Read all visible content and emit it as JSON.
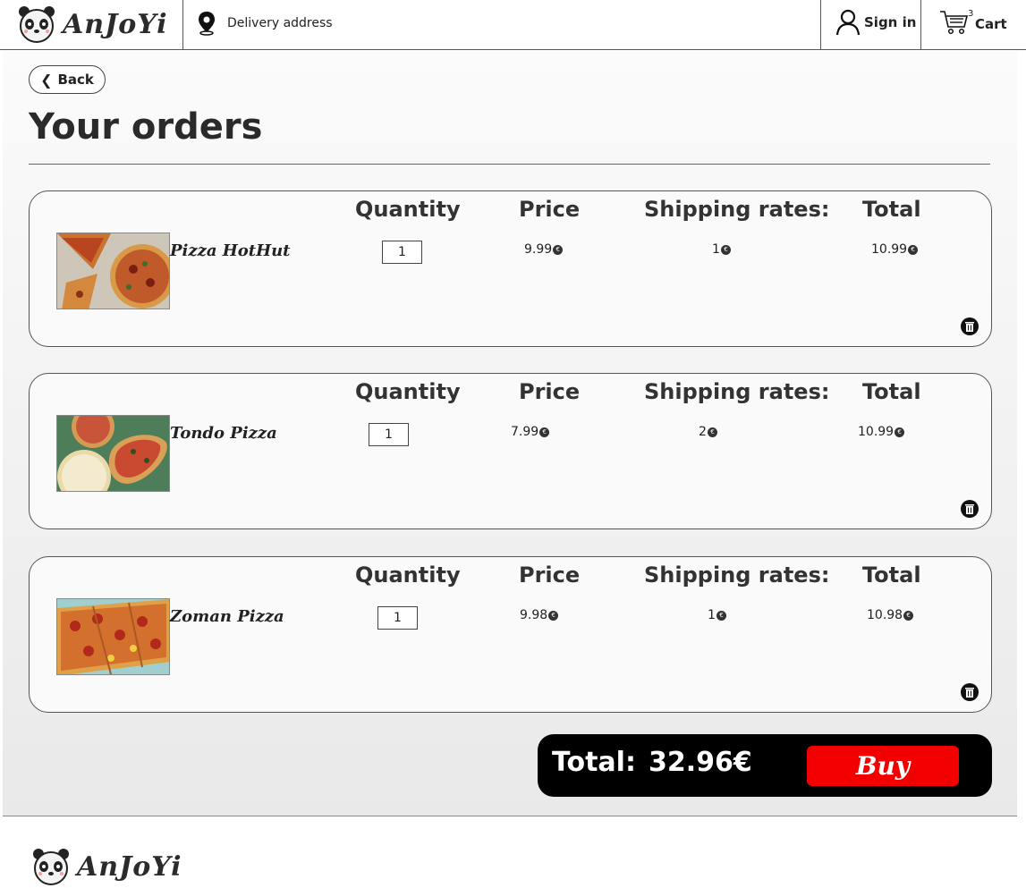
{
  "header": {
    "brand": "AnJoYi",
    "delivery_label": "Delivery address",
    "signin_label": "Sign in",
    "cart_label": "Cart",
    "cart_count": "3"
  },
  "page": {
    "back_label": "Back",
    "title": "Your orders"
  },
  "columns": {
    "quantity": "Quantity",
    "price": "Price",
    "shipping": "Shipping rates:",
    "total": "Total"
  },
  "orders": [
    {
      "name": "Pizza HotHut",
      "quantity": "1",
      "price": "9.99",
      "shipping": "1",
      "total": "10.99"
    },
    {
      "name": "Tondo Pizza",
      "quantity": "1",
      "price": "7.99",
      "shipping": "2",
      "total": "10.99"
    },
    {
      "name": "Zoman Pizza",
      "quantity": "1",
      "price": "9.98",
      "shipping": "1",
      "total": "10.98"
    }
  ],
  "summary": {
    "total_label": "Total:",
    "total_value": "32.96€",
    "buy_label": "Buy"
  },
  "currency_symbol": "€",
  "footer": {
    "brand": "AnJoYi"
  },
  "colors": {
    "buy": "#f20000",
    "total_bar": "#000000"
  }
}
